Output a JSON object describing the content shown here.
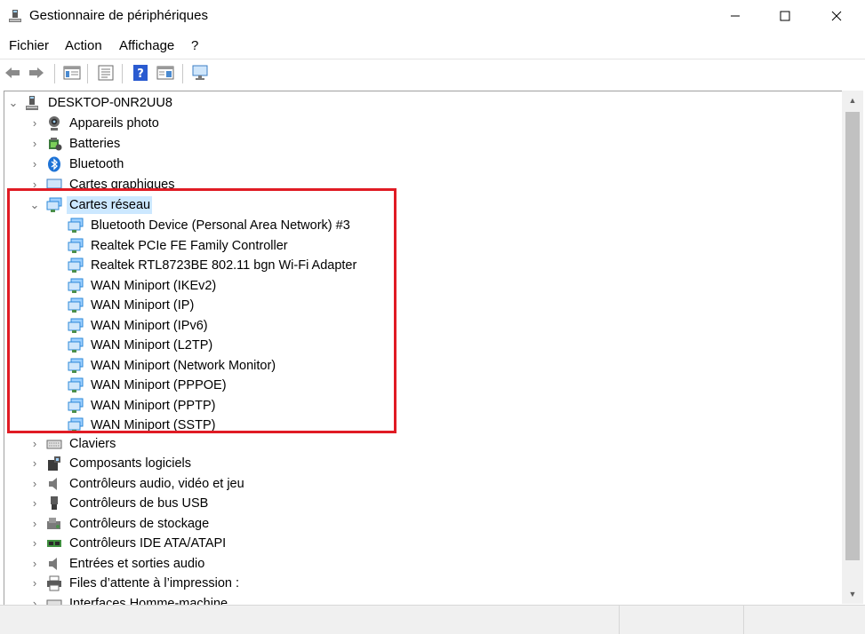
{
  "window": {
    "title": "Gestionnaire de périphériques"
  },
  "menu": [
    "Fichier",
    "Action",
    "Affichage",
    "?"
  ],
  "toolbar": {
    "buttons": [
      "back",
      "forward",
      "show-hide-console-tree",
      "properties",
      "help",
      "update-driver",
      "scan-hardware"
    ]
  },
  "tree": {
    "root": "DESKTOP-0NR2UU8",
    "categories_before": [
      {
        "label": "Appareils photo",
        "icon": "camera-icon"
      },
      {
        "label": "Batteries",
        "icon": "battery-icon"
      },
      {
        "label": "Bluetooth",
        "icon": "bluetooth-icon"
      },
      {
        "label": "Cartes graphiques",
        "icon": "display-adapter-icon"
      }
    ],
    "expanded": {
      "label": "Cartes réseau",
      "icon": "network-adapter-icon",
      "children": [
        "Bluetooth Device (Personal Area Network) #3",
        "Realtek PCIe FE Family Controller",
        "Realtek RTL8723BE 802.11 bgn Wi-Fi Adapter",
        "WAN Miniport (IKEv2)",
        "WAN Miniport (IP)",
        "WAN Miniport (IPv6)",
        "WAN Miniport (L2TP)",
        "WAN Miniport (Network Monitor)",
        "WAN Miniport (PPPOE)",
        "WAN Miniport (PPTP)",
        "WAN Miniport (SSTP)"
      ]
    },
    "categories_after": [
      {
        "label": "Claviers",
        "icon": "keyboard-icon"
      },
      {
        "label": "Composants logiciels",
        "icon": "software-component-icon"
      },
      {
        "label": "Contrôleurs audio, vidéo et jeu",
        "icon": "speaker-icon"
      },
      {
        "label": "Contrôleurs de bus USB",
        "icon": "usb-icon"
      },
      {
        "label": "Contrôleurs de stockage",
        "icon": "storage-controller-icon"
      },
      {
        "label": "Contrôleurs IDE ATA/ATAPI",
        "icon": "ide-controller-icon"
      },
      {
        "label": "Entrées et sorties audio",
        "icon": "audio-io-icon"
      },
      {
        "label": "Files d’attente à l’impression :",
        "icon": "printer-icon"
      },
      {
        "label": "Interfaces Homme-machine",
        "icon": "hid-icon"
      }
    ]
  },
  "colors": {
    "selection": "#cce8ff",
    "highlight_box": "#e01b24",
    "network_icon": "#2b88d8"
  }
}
